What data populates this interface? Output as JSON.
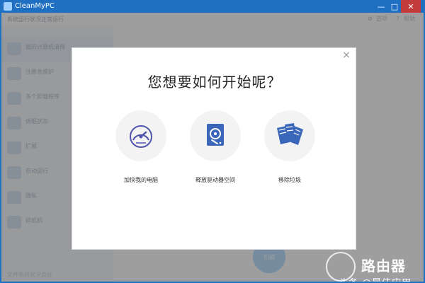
{
  "window": {
    "title": "CleanMyPC",
    "controls": [
      "—",
      "□",
      "✕"
    ]
  },
  "background": {
    "status": "系统运行状况正常运行",
    "top_actions": [
      {
        "icon": "gear-icon",
        "label": "选项"
      },
      {
        "icon": "help-icon",
        "label": "帮助"
      }
    ],
    "sidebar": [
      {
        "label": "我的计算机清理",
        "icon": "computer-clean-icon",
        "active": true
      },
      {
        "label": "注册表维护",
        "icon": "registry-icon"
      },
      {
        "label": "多个卸载程序",
        "icon": "uninstaller-icon"
      },
      {
        "label": "休眠状态",
        "icon": "hibernation-icon"
      },
      {
        "label": "扩展",
        "icon": "extensions-icon"
      },
      {
        "label": "自动运行",
        "icon": "autorun-icon"
      },
      {
        "label": "隐私",
        "icon": "privacy-icon"
      },
      {
        "label": "碎纸机",
        "icon": "shredder-icon"
      }
    ],
    "bottom": "文件系统状况良好",
    "scan_button": "扫描"
  },
  "dialog": {
    "question": "您想要如何开始呢？",
    "options": [
      {
        "label": "加快我的电脑",
        "icon": "speedometer-icon"
      },
      {
        "label": "释放驱动器空间",
        "icon": "drive-icon"
      },
      {
        "label": "移除垃圾",
        "icon": "files-icon"
      }
    ]
  },
  "watermark": {
    "brand": "路由器",
    "footer": "头条 @最佳应用"
  },
  "colors": {
    "title_bar": "#1f6fc3",
    "close_button": "#c33b3b",
    "accent": "#3a67b9"
  }
}
